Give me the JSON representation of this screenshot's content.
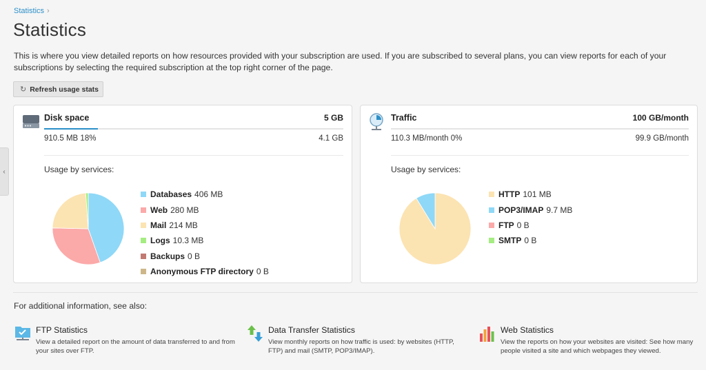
{
  "breadcrumb": {
    "item": "Statistics",
    "separator": "›"
  },
  "page": {
    "title": "Statistics",
    "intro": "This is where you view detailed reports on how resources provided with your subscription are used. If you are subscribed to several plans, you can view reports for each of your subscriptions by selecting the required subscription at the top right corner of the page."
  },
  "refresh_button": {
    "icon": "refresh-icon",
    "label": "Refresh usage stats"
  },
  "side_toggle": {
    "glyph": "‹"
  },
  "disk": {
    "icon": "hard-drive-icon",
    "title": "Disk space",
    "total": "5 GB",
    "usage_fraction": 0.18,
    "used": "910.5 MB 18%",
    "free": "4.1 GB",
    "usage_label": "Usage by services:",
    "services": [
      {
        "name": "Databases",
        "value": "406 MB",
        "amount_mb": 406,
        "color": "#8fd8f7"
      },
      {
        "name": "Web",
        "value": "280 MB",
        "amount_mb": 280,
        "color": "#fca9a9"
      },
      {
        "name": "Mail",
        "value": "214 MB",
        "amount_mb": 214,
        "color": "#fce3b2"
      },
      {
        "name": "Logs",
        "value": "10.3 MB",
        "amount_mb": 10.3,
        "color": "#a5ed82"
      },
      {
        "name": "Backups",
        "value": "0 B",
        "amount_mb": 0,
        "color": "#c27a72"
      },
      {
        "name": "Anonymous FTP directory",
        "value": "0 B",
        "amount_mb": 0,
        "color": "#cdb78a"
      }
    ]
  },
  "traffic": {
    "icon": "traffic-clock-icon",
    "title": "Traffic",
    "total": "100 GB/month",
    "usage_fraction": 0.0,
    "used": "110.3 MB/month 0%",
    "free": "99.9 GB/month",
    "usage_label": "Usage by services:",
    "services": [
      {
        "name": "HTTP",
        "value": "101 MB",
        "amount_mb": 101,
        "color": "#fce3b2"
      },
      {
        "name": "POP3/IMAP",
        "value": "9.7 MB",
        "amount_mb": 9.7,
        "color": "#8fd8f7"
      },
      {
        "name": "FTP",
        "value": "0 B",
        "amount_mb": 0,
        "color": "#fca9a9"
      },
      {
        "name": "SMTP",
        "value": "0 B",
        "amount_mb": 0,
        "color": "#a5ed82"
      }
    ]
  },
  "see_also": {
    "heading": "For additional information, see also:",
    "links": [
      {
        "icon": "ftp-folder-icon",
        "title": "FTP Statistics",
        "description": "View a detailed report on the amount of data transferred to and from your sites over FTP."
      },
      {
        "icon": "data-transfer-icon",
        "title": "Data Transfer Statistics",
        "description": "View monthly reports on how traffic is used: by websites (HTTP, FTP) and mail (SMTP, POP3/IMAP)."
      },
      {
        "icon": "web-stats-icon",
        "title": "Web Statistics",
        "description": "View the reports on how your websites are visited: See how many people visited a site and which webpages they viewed."
      }
    ]
  }
}
